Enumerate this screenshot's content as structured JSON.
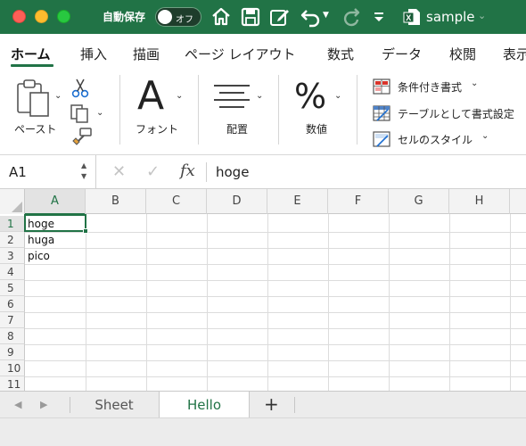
{
  "titlebar": {
    "autosave_label": "自動保存",
    "autosave_state": "オフ",
    "document_name": "sample",
    "icons": [
      "home-icon",
      "save-icon",
      "edit-icon",
      "undo-icon",
      "redo-icon",
      "customize-icon",
      "excel-doc-icon"
    ]
  },
  "ribbon_tabs": [
    {
      "label": "ホーム",
      "active": true
    },
    {
      "label": "挿入"
    },
    {
      "label": "描画"
    },
    {
      "label": "ページ レイアウト"
    },
    {
      "label": "数式"
    },
    {
      "label": "データ"
    },
    {
      "label": "校閲"
    },
    {
      "label": "表示"
    }
  ],
  "ribbon": {
    "paste_label": "ペースト",
    "font_label": "フォント",
    "align_label": "配置",
    "number_label": "数値",
    "styles": {
      "conditional": "条件付き書式",
      "table": "テーブルとして書式設定",
      "cell": "セルのスタイル"
    }
  },
  "formula_bar": {
    "name_box": "A1",
    "fx_label": "fx",
    "content": "hoge"
  },
  "grid": {
    "columns": [
      "A",
      "B",
      "C",
      "D",
      "E",
      "F",
      "G",
      "H"
    ],
    "rows": [
      "1",
      "2",
      "3",
      "4",
      "5",
      "6",
      "7",
      "8",
      "9",
      "10",
      "11"
    ],
    "selected_cell": "A1",
    "cells": [
      {
        "ref": "A1",
        "value": "hoge"
      },
      {
        "ref": "A2",
        "value": "huga"
      },
      {
        "ref": "A3",
        "value": "pico"
      }
    ]
  },
  "sheets": {
    "tabs": [
      {
        "label": "Sheet",
        "active": false
      },
      {
        "label": "Hello",
        "active": true
      }
    ],
    "add_label": "+"
  },
  "colors": {
    "accent": "#217346",
    "title_bar": "#217346"
  }
}
